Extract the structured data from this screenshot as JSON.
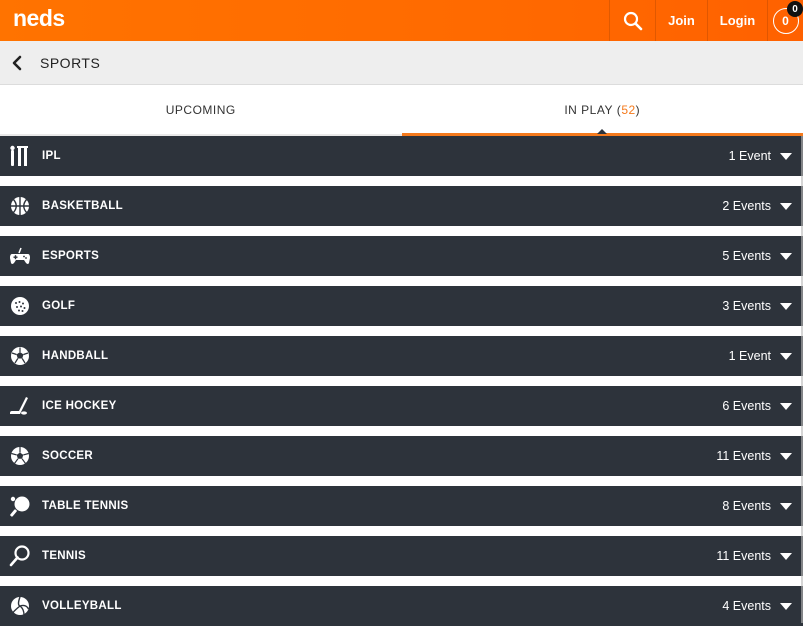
{
  "header": {
    "logo": "neds",
    "join_label": "Join",
    "login_label": "Login",
    "betslip_count": "0",
    "betslip_badge": "0",
    "search_icon": "search-icon"
  },
  "subheader": {
    "title": "SPORTS",
    "back_icon": "chevron-left-icon"
  },
  "tabs": [
    {
      "label": "UPCOMING",
      "count": ""
    },
    {
      "label": "IN PLAY",
      "count": "52"
    }
  ],
  "sports": [
    {
      "name": "IPL",
      "events": "1 Event",
      "icon": "cricket-icon"
    },
    {
      "name": "BASKETBALL",
      "events": "2 Events",
      "icon": "basketball-icon"
    },
    {
      "name": "ESPORTS",
      "events": "5 Events",
      "icon": "gamepad-icon"
    },
    {
      "name": "GOLF",
      "events": "3 Events",
      "icon": "golf-ball-icon"
    },
    {
      "name": "HANDBALL",
      "events": "1 Event",
      "icon": "handball-icon"
    },
    {
      "name": "ICE HOCKEY",
      "events": "6 Events",
      "icon": "hockey-stick-icon"
    },
    {
      "name": "SOCCER",
      "events": "11 Events",
      "icon": "soccer-ball-icon"
    },
    {
      "name": "TABLE TENNIS",
      "events": "8 Events",
      "icon": "table-tennis-icon"
    },
    {
      "name": "TENNIS",
      "events": "11 Events",
      "icon": "tennis-racket-icon"
    },
    {
      "name": "VOLLEYBALL",
      "events": "4 Events",
      "icon": "volleyball-icon"
    }
  ],
  "colors": {
    "brand_orange": "#ff6a00",
    "accent_orange": "#f57a1c",
    "row_dark": "#2d333b",
    "subheader_bg": "#eeeeee"
  }
}
